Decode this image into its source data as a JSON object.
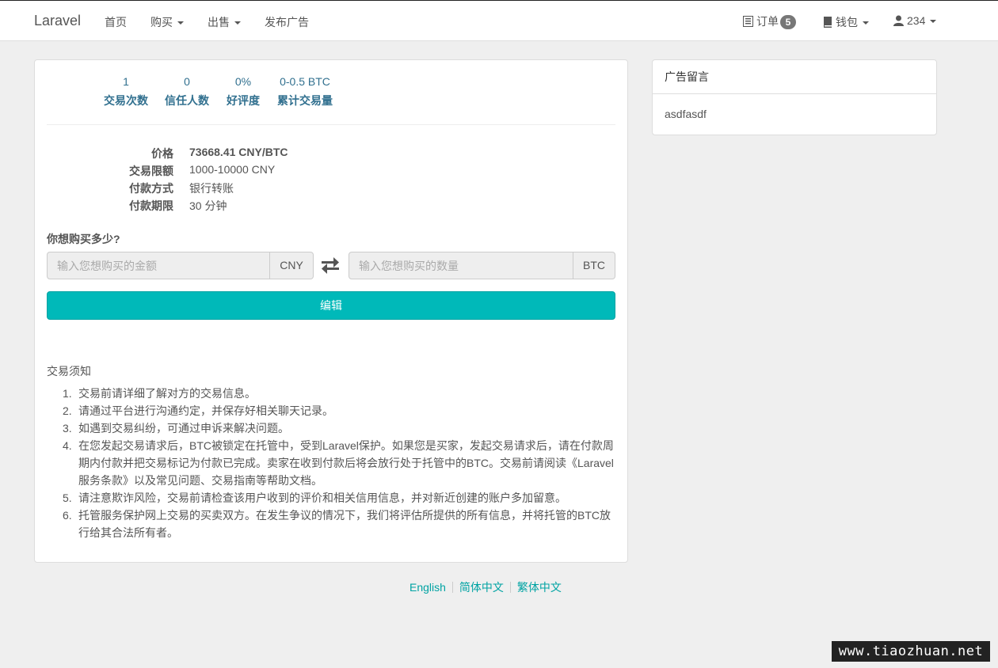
{
  "nav": {
    "brand": "Laravel",
    "home": "首页",
    "buy": "购买",
    "sell": "出售",
    "post_ad": "发布广告",
    "orders": "订单",
    "orders_count": "5",
    "wallet": "钱包",
    "user": "234"
  },
  "stats": [
    {
      "value": "1",
      "label": "交易次数"
    },
    {
      "value": "0",
      "label": "信任人数"
    },
    {
      "value": "0%",
      "label": "好评度"
    },
    {
      "value": "0-0.5 BTC",
      "label": "累计交易量"
    }
  ],
  "details": {
    "price_label": "价格",
    "price_value": "73668.41 CNY/BTC",
    "limit_label": "交易限额",
    "limit_value": "1000-10000 CNY",
    "payment_label": "付款方式",
    "payment_value": "银行转账",
    "period_label": "付款期限",
    "period_value": "30 分钟"
  },
  "buy_form": {
    "question": "你想购买多少?",
    "amount_placeholder": "输入您想购买的金额",
    "amount_unit": "CNY",
    "qty_placeholder": "输入您想购买的数量",
    "qty_unit": "BTC",
    "submit_label": "编辑"
  },
  "notice": {
    "title": "交易须知",
    "items": [
      "交易前请详细了解对方的交易信息。",
      "请通过平台进行沟通约定，并保存好相关聊天记录。",
      "如遇到交易纠纷，可通过申诉来解决问题。",
      "在您发起交易请求后，BTC被锁定在托管中，受到Laravel保护。如果您是买家，发起交易请求后，请在付款周期内付款并把交易标记为付款已完成。卖家在收到付款后将会放行处于托管中的BTC。交易前请阅读《Laravel服务条款》以及常见问题、交易指南等帮助文档。",
      "请注意欺诈风险，交易前请检查该用户收到的评价和相关信用信息，并对新近创建的账户多加留意。",
      "托管服务保护网上交易的买卖双方。在发生争议的情况下，我们将评估所提供的所有信息，并将托管的BTC放行给其合法所有者。"
    ]
  },
  "side": {
    "title": "广告留言",
    "message": "asdfasdf"
  },
  "footer": {
    "lang_en": "English",
    "lang_sc": "简体中文",
    "lang_tc": "繁体中文"
  },
  "watermark": "www.tiaozhuan.net"
}
